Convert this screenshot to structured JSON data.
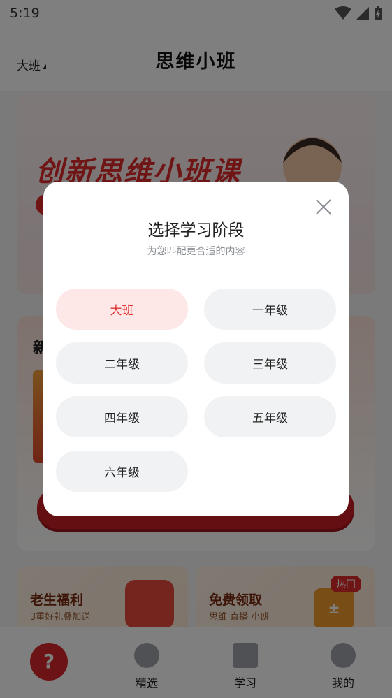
{
  "status_bar": {
    "time": "5:19"
  },
  "header": {
    "grade_selector": "大班",
    "title": "思维小班"
  },
  "banner": {
    "title": "创新思维小班课"
  },
  "promo": {
    "title": "新"
  },
  "cards": [
    {
      "title": "老生福利",
      "subtitle": "3重好礼叠加送"
    },
    {
      "title": "免费领取",
      "subtitle": "思维 直播 小班",
      "badge": "热门"
    }
  ],
  "tabs": [
    {
      "label": "精选"
    },
    {
      "label": "学习"
    },
    {
      "label": "我的"
    }
  ],
  "dialog": {
    "title": "选择学习阶段",
    "subtitle": "为您匹配更合适的内容",
    "selected": "大班",
    "options": [
      "大班",
      "一年级",
      "二年级",
      "三年级",
      "四年级",
      "五年级",
      "六年级"
    ]
  },
  "colors": {
    "accent": "#e03535",
    "selected_bg": "#fde8e7",
    "option_bg": "#f1f2f4"
  }
}
